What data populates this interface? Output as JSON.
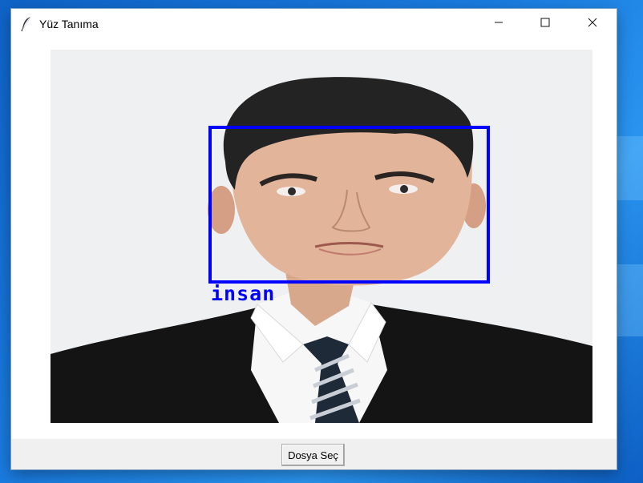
{
  "window": {
    "title": "Yüz Tanıma",
    "app_icon": "feather-icon",
    "controls": {
      "minimize": "minimize-icon",
      "maximize": "maximize-icon",
      "close": "close-icon"
    }
  },
  "detection": {
    "label": "insan",
    "box_color": "#0000ff"
  },
  "actions": {
    "select_file_label": "Dosya Seç"
  },
  "colors": {
    "desktop": "#1a7ce0",
    "window_bg": "#f0f0f0",
    "detection_box": "#0000ff"
  }
}
